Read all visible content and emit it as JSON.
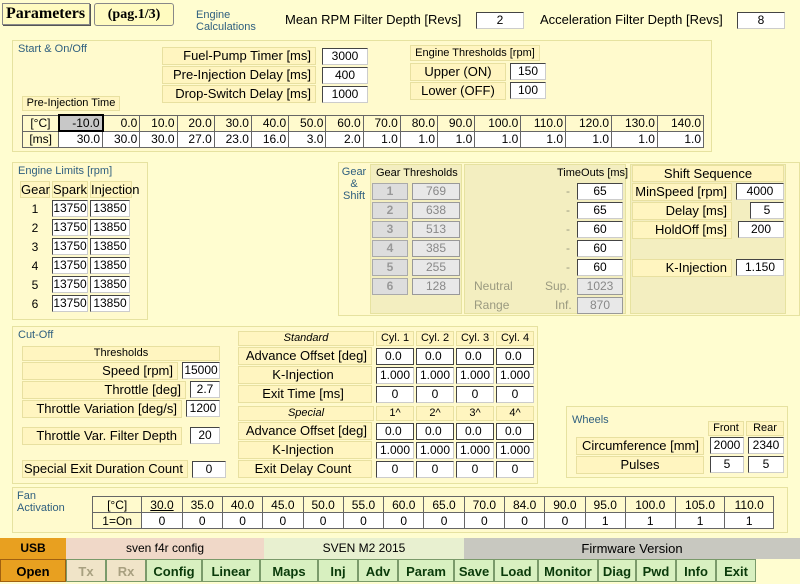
{
  "header": {
    "title": "Parameters",
    "page": "(pag.1/3)",
    "engine_calc": "Engine Calculations",
    "rpm_filter_label": "Mean RPM Filter Depth [Revs]",
    "rpm_filter_value": "2",
    "accel_filter_label": "Acceleration Filter Depth [Revs]",
    "accel_filter_value": "8"
  },
  "start": {
    "group": "Start & On/Off",
    "fuel_pump_label": "Fuel-Pump Timer [ms]",
    "fuel_pump_value": "3000",
    "preinj_delay_label": "Pre-Injection Delay [ms]",
    "preinj_delay_value": "400",
    "dropswitch_label": "Drop-Switch Delay [ms]",
    "dropswitch_value": "1000",
    "thresholds_title": "Engine Thresholds [rpm]",
    "upper_label": "Upper (ON)",
    "upper_value": "150",
    "lower_label": "Lower (OFF)",
    "lower_value": "100",
    "preinj_time": "Pre-Injection Time",
    "temp_head": "[°C]",
    "ms_head": "[ms]",
    "temps": [
      "-10.0",
      "0.0",
      "10.0",
      "20.0",
      "30.0",
      "40.0",
      "50.0",
      "60.0",
      "70.0",
      "80.0",
      "90.0",
      "100.0",
      "110.0",
      "120.0",
      "130.0",
      "140.0"
    ],
    "times": [
      "30.0",
      "30.0",
      "30.0",
      "27.0",
      "23.0",
      "16.0",
      "3.0",
      "2.0",
      "1.0",
      "1.0",
      "1.0",
      "1.0",
      "1.0",
      "1.0",
      "1.0",
      "1.0"
    ]
  },
  "limits": {
    "group": "Engine Limits [rpm]",
    "h_gear": "Gear",
    "h_spark": "Spark",
    "h_inj": "Injection",
    "rows": [
      {
        "g": "1",
        "s": "13750",
        "i": "13850"
      },
      {
        "g": "2",
        "s": "13750",
        "i": "13850"
      },
      {
        "g": "3",
        "s": "13750",
        "i": "13850"
      },
      {
        "g": "4",
        "s": "13750",
        "i": "13850"
      },
      {
        "g": "5",
        "s": "13750",
        "i": "13850"
      },
      {
        "g": "6",
        "s": "13750",
        "i": "13850"
      }
    ]
  },
  "gear": {
    "group": "Gear & Shift",
    "thresholds": "Gear Thresholds",
    "timeouts": "TimeOuts [ms]",
    "rows": [
      {
        "n": "1",
        "t": "769",
        "o": "65"
      },
      {
        "n": "2",
        "t": "638",
        "o": "65"
      },
      {
        "n": "3",
        "t": "513",
        "o": "60"
      },
      {
        "n": "4",
        "t": "385",
        "o": "60"
      },
      {
        "n": "5",
        "t": "255",
        "o": "60"
      },
      {
        "n": "6",
        "t": "128"
      }
    ],
    "dash": "-",
    "neutral": "Neutral",
    "range": "Range",
    "sup": "Sup.",
    "sup_val": "1023",
    "inf": "Inf.",
    "inf_val": "870"
  },
  "shift": {
    "title": "Shift Sequence",
    "minspeed_label": "MinSpeed [rpm]",
    "minspeed": "4000",
    "delay_label": "Delay [ms]",
    "delay": "5",
    "holdoff_label": "HoldOff [ms]",
    "holdoff": "200",
    "kinj_label": "K-Injection",
    "kinj": "1.150"
  },
  "cutoff": {
    "group": "Cut-Off",
    "thresholds": "Thresholds",
    "speed_label": "Speed [rpm]",
    "speed": "15000",
    "throttle_label": "Throttle [deg]",
    "throttle": "2.7",
    "tvar_label": "Throttle Variation [deg/s]",
    "tvar": "1200",
    "tvf_label": "Throttle Var. Filter Depth",
    "tvf": "20",
    "sedc_label": "Special Exit Duration Count",
    "sedc": "0",
    "std": "Standard",
    "cyl": [
      "Cyl. 1",
      "Cyl. 2",
      "Cyl. 3",
      "Cyl. 4"
    ],
    "adv_label": "Advance Offset [deg]",
    "adv": [
      "0.0",
      "0.0",
      "0.0",
      "0.0"
    ],
    "kinj_label": "K-Injection",
    "kinj": [
      "1.000",
      "1.000",
      "1.000",
      "1.000"
    ],
    "exit_label": "Exit Time [ms]",
    "exit": [
      "0",
      "0",
      "0",
      "0"
    ],
    "special": "Special",
    "sp_cyl": [
      "1^",
      "2^",
      "3^",
      "4^"
    ],
    "sp_adv": [
      "0.0",
      "0.0",
      "0.0",
      "0.0"
    ],
    "sp_kinj": [
      "1.000",
      "1.000",
      "1.000",
      "1.000"
    ],
    "sp_exit_label": "Exit Delay Count",
    "sp_exit": [
      "0",
      "0",
      "0",
      "0"
    ]
  },
  "wheels": {
    "group": "Wheels",
    "front": "Front",
    "rear": "Rear",
    "circ_label": "Circumference [mm]",
    "circ_f": "2000",
    "circ_r": "2340",
    "pulses_label": "Pulses",
    "pulses_f": "5",
    "pulses_r": "5"
  },
  "fan": {
    "group": "Fan Activation",
    "h_temp": "[°C]",
    "h_on": "1=On",
    "temps": [
      "30.0",
      "35.0",
      "40.0",
      "45.0",
      "50.0",
      "55.0",
      "60.0",
      "65.0",
      "70.0",
      "84.0",
      "90.0",
      "95.0",
      "100.0",
      "105.0",
      "110.0"
    ],
    "on": [
      "0",
      "0",
      "0",
      "0",
      "0",
      "0",
      "0",
      "0",
      "0",
      "0",
      "0",
      "1",
      "1",
      "1",
      "1"
    ]
  },
  "bottom": {
    "usb": "USB",
    "config": "sven f4r config",
    "sven": "SVEN M2 2015",
    "firmware": "Firmware Version",
    "buttons": [
      "Open",
      "Tx",
      "Rx",
      "Config",
      "Linear",
      "Maps",
      "Inj",
      "Adv",
      "Param",
      "Save",
      "Load",
      "Monitor",
      "Diag",
      "Pwd",
      "Info",
      "Exit"
    ]
  },
  "colors": {
    "bg": "#fffdd0",
    "group_text": "#2f5f7f",
    "button_green": "#d8f0c0",
    "usb_orange": "#e8a020"
  }
}
